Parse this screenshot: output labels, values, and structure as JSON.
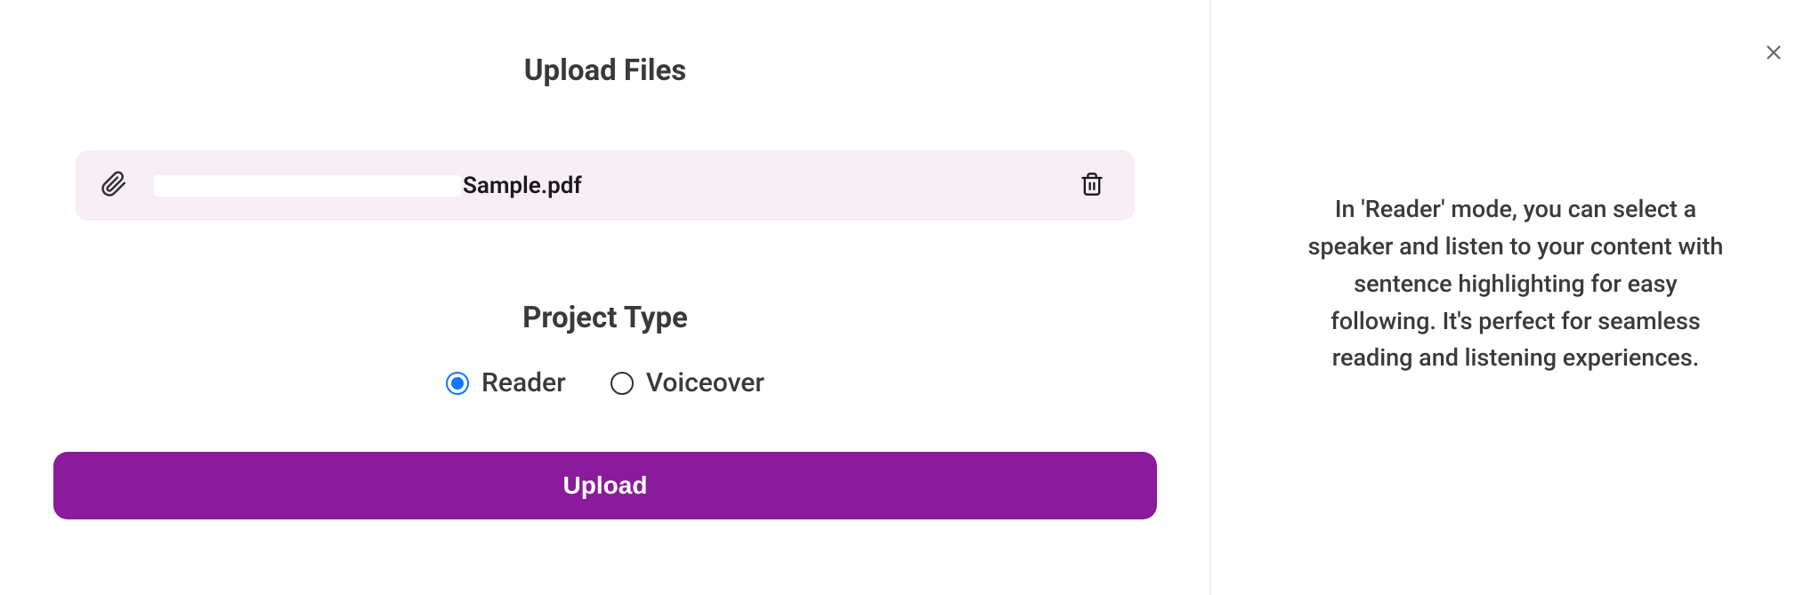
{
  "main": {
    "title": "Upload Files",
    "file": {
      "name": "Sample.pdf"
    },
    "projectType": {
      "title": "Project Type",
      "options": [
        {
          "label": "Reader",
          "selected": true
        },
        {
          "label": "Voiceover",
          "selected": false
        }
      ]
    },
    "uploadButton": "Upload"
  },
  "sidebar": {
    "infoText": "In 'Reader' mode, you can select a speaker and listen to your content with sentence highlighting for easy following. It's perfect for seamless reading and listening experiences."
  }
}
